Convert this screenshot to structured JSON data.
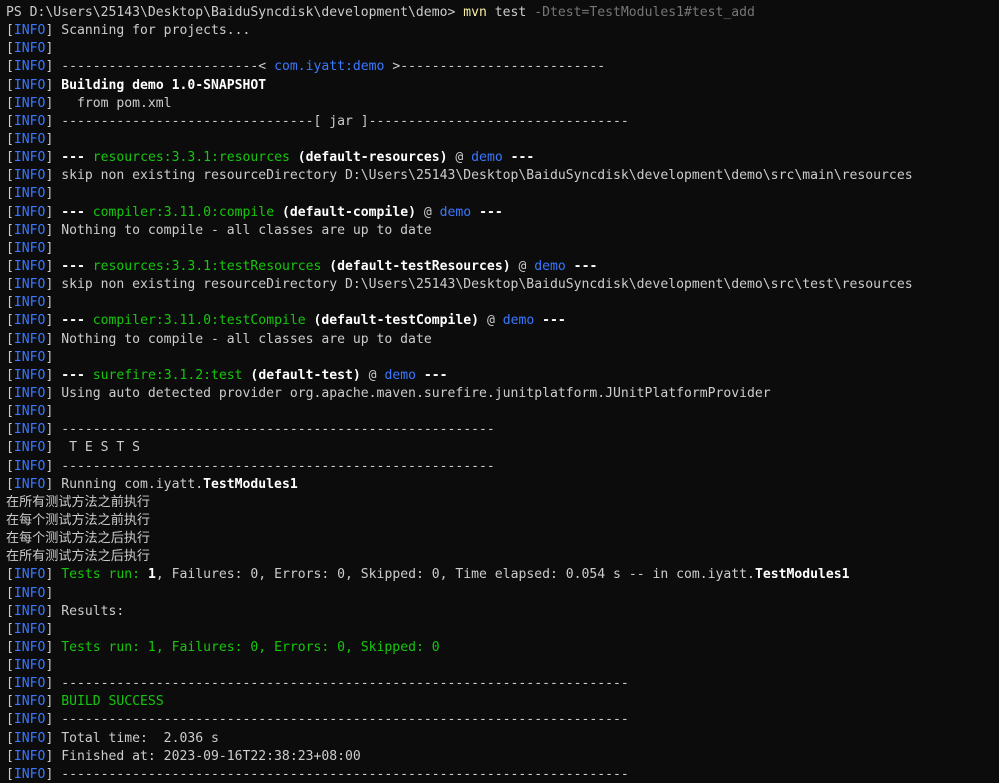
{
  "colors": {
    "background": "#0c0c0c",
    "text": "#cccccc",
    "info": "#3b78ff",
    "plugin": "#16c60c",
    "artifact": "#3b78ff",
    "command": "#f9f1a5",
    "argument": "#767676"
  },
  "prompt": {
    "path": "PS D:\\Users\\25143\\Desktop\\BaiduSyncdisk\\development\\demo> ",
    "command": "mvn",
    "sub": " test ",
    "args": "-Dtest=TestModules1#test_add"
  },
  "lines": [
    [
      {
        "t": "[",
        "c": "gray"
      },
      {
        "t": "INFO",
        "c": "blue"
      },
      {
        "t": "] Scanning for projects...",
        "c": "gray"
      }
    ],
    [
      {
        "t": "[",
        "c": "gray"
      },
      {
        "t": "INFO",
        "c": "blue"
      },
      {
        "t": "]",
        "c": "gray"
      }
    ],
    [
      {
        "t": "[",
        "c": "gray"
      },
      {
        "t": "INFO",
        "c": "blue"
      },
      {
        "t": "] -------------------------< ",
        "c": "gray"
      },
      {
        "t": "com.iyatt:demo",
        "c": "blue"
      },
      {
        "t": " >--------------------------",
        "c": "gray"
      }
    ],
    [
      {
        "t": "[",
        "c": "gray"
      },
      {
        "t": "INFO",
        "c": "blue"
      },
      {
        "t": "] ",
        "c": "gray"
      },
      {
        "t": "Building demo 1.0-SNAPSHOT",
        "c": "bold"
      }
    ],
    [
      {
        "t": "[",
        "c": "gray"
      },
      {
        "t": "INFO",
        "c": "blue"
      },
      {
        "t": "]   from pom.xml",
        "c": "gray"
      }
    ],
    [
      {
        "t": "[",
        "c": "gray"
      },
      {
        "t": "INFO",
        "c": "blue"
      },
      {
        "t": "] --------------------------------[ jar ]---------------------------------",
        "c": "gray"
      }
    ],
    [
      {
        "t": "[",
        "c": "gray"
      },
      {
        "t": "INFO",
        "c": "blue"
      },
      {
        "t": "]",
        "c": "gray"
      }
    ],
    [
      {
        "t": "[",
        "c": "gray"
      },
      {
        "t": "INFO",
        "c": "blue"
      },
      {
        "t": "] ",
        "c": "gray"
      },
      {
        "t": "--- ",
        "c": "bold"
      },
      {
        "t": "resources:3.3.1:resources",
        "c": "green"
      },
      {
        "t": " (default-resources)",
        "c": "bold"
      },
      {
        "t": " @ ",
        "c": "gray"
      },
      {
        "t": "demo",
        "c": "blue"
      },
      {
        "t": " ---",
        "c": "bold"
      }
    ],
    [
      {
        "t": "[",
        "c": "gray"
      },
      {
        "t": "INFO",
        "c": "blue"
      },
      {
        "t": "] skip non existing resourceDirectory D:\\Users\\25143\\Desktop\\BaiduSyncdisk\\development\\demo\\src\\main\\resources",
        "c": "gray"
      }
    ],
    [
      {
        "t": "[",
        "c": "gray"
      },
      {
        "t": "INFO",
        "c": "blue"
      },
      {
        "t": "]",
        "c": "gray"
      }
    ],
    [
      {
        "t": "[",
        "c": "gray"
      },
      {
        "t": "INFO",
        "c": "blue"
      },
      {
        "t": "] ",
        "c": "gray"
      },
      {
        "t": "--- ",
        "c": "bold"
      },
      {
        "t": "compiler:3.11.0:compile",
        "c": "green"
      },
      {
        "t": " (default-compile)",
        "c": "bold"
      },
      {
        "t": " @ ",
        "c": "gray"
      },
      {
        "t": "demo",
        "c": "blue"
      },
      {
        "t": " ---",
        "c": "bold"
      }
    ],
    [
      {
        "t": "[",
        "c": "gray"
      },
      {
        "t": "INFO",
        "c": "blue"
      },
      {
        "t": "] Nothing to compile - all classes are up to date",
        "c": "gray"
      }
    ],
    [
      {
        "t": "[",
        "c": "gray"
      },
      {
        "t": "INFO",
        "c": "blue"
      },
      {
        "t": "]",
        "c": "gray"
      }
    ],
    [
      {
        "t": "[",
        "c": "gray"
      },
      {
        "t": "INFO",
        "c": "blue"
      },
      {
        "t": "] ",
        "c": "gray"
      },
      {
        "t": "--- ",
        "c": "bold"
      },
      {
        "t": "resources:3.3.1:testResources",
        "c": "green"
      },
      {
        "t": " (default-testResources)",
        "c": "bold"
      },
      {
        "t": " @ ",
        "c": "gray"
      },
      {
        "t": "demo",
        "c": "blue"
      },
      {
        "t": " ---",
        "c": "bold"
      }
    ],
    [
      {
        "t": "[",
        "c": "gray"
      },
      {
        "t": "INFO",
        "c": "blue"
      },
      {
        "t": "] skip non existing resourceDirectory D:\\Users\\25143\\Desktop\\BaiduSyncdisk\\development\\demo\\src\\test\\resources",
        "c": "gray"
      }
    ],
    [
      {
        "t": "[",
        "c": "gray"
      },
      {
        "t": "INFO",
        "c": "blue"
      },
      {
        "t": "]",
        "c": "gray"
      }
    ],
    [
      {
        "t": "[",
        "c": "gray"
      },
      {
        "t": "INFO",
        "c": "blue"
      },
      {
        "t": "] ",
        "c": "gray"
      },
      {
        "t": "--- ",
        "c": "bold"
      },
      {
        "t": "compiler:3.11.0:testCompile",
        "c": "green"
      },
      {
        "t": " (default-testCompile)",
        "c": "bold"
      },
      {
        "t": " @ ",
        "c": "gray"
      },
      {
        "t": "demo",
        "c": "blue"
      },
      {
        "t": " ---",
        "c": "bold"
      }
    ],
    [
      {
        "t": "[",
        "c": "gray"
      },
      {
        "t": "INFO",
        "c": "blue"
      },
      {
        "t": "] Nothing to compile - all classes are up to date",
        "c": "gray"
      }
    ],
    [
      {
        "t": "[",
        "c": "gray"
      },
      {
        "t": "INFO",
        "c": "blue"
      },
      {
        "t": "]",
        "c": "gray"
      }
    ],
    [
      {
        "t": "[",
        "c": "gray"
      },
      {
        "t": "INFO",
        "c": "blue"
      },
      {
        "t": "] ",
        "c": "gray"
      },
      {
        "t": "--- ",
        "c": "bold"
      },
      {
        "t": "surefire:3.1.2:test",
        "c": "green"
      },
      {
        "t": " (default-test)",
        "c": "bold"
      },
      {
        "t": " @ ",
        "c": "gray"
      },
      {
        "t": "demo",
        "c": "blue"
      },
      {
        "t": " ---",
        "c": "bold"
      }
    ],
    [
      {
        "t": "[",
        "c": "gray"
      },
      {
        "t": "INFO",
        "c": "blue"
      },
      {
        "t": "] Using auto detected provider org.apache.maven.surefire.junitplatform.JUnitPlatformProvider",
        "c": "gray"
      }
    ],
    [
      {
        "t": "[",
        "c": "gray"
      },
      {
        "t": "INFO",
        "c": "blue"
      },
      {
        "t": "]",
        "c": "gray"
      }
    ],
    [
      {
        "t": "[",
        "c": "gray"
      },
      {
        "t": "INFO",
        "c": "blue"
      },
      {
        "t": "] -------------------------------------------------------",
        "c": "gray"
      }
    ],
    [
      {
        "t": "[",
        "c": "gray"
      },
      {
        "t": "INFO",
        "c": "blue"
      },
      {
        "t": "]  T E S T S",
        "c": "gray"
      }
    ],
    [
      {
        "t": "[",
        "c": "gray"
      },
      {
        "t": "INFO",
        "c": "blue"
      },
      {
        "t": "] -------------------------------------------------------",
        "c": "gray"
      }
    ],
    [
      {
        "t": "[",
        "c": "gray"
      },
      {
        "t": "INFO",
        "c": "blue"
      },
      {
        "t": "] Running com.iyatt.",
        "c": "gray"
      },
      {
        "t": "TestModules1",
        "c": "bold"
      }
    ],
    [
      {
        "t": "在所有测试方法之前执行",
        "c": "gray",
        "cjk": true
      }
    ],
    [
      {
        "t": "在每个测试方法之前执行",
        "c": "gray",
        "cjk": true
      }
    ],
    [
      {
        "t": "在每个测试方法之后执行",
        "c": "gray",
        "cjk": true
      }
    ],
    [
      {
        "t": "在所有测试方法之后执行",
        "c": "gray",
        "cjk": true
      }
    ],
    [
      {
        "t": "[",
        "c": "gray"
      },
      {
        "t": "INFO",
        "c": "blue"
      },
      {
        "t": "] ",
        "c": "gray"
      },
      {
        "t": "Tests run: ",
        "c": "green"
      },
      {
        "t": "1",
        "c": "bold"
      },
      {
        "t": ", Failures: 0, Errors: 0, Skipped: 0, Time elapsed: 0.054 s -- in com.iyatt.",
        "c": "gray"
      },
      {
        "t": "TestModules1",
        "c": "bold"
      }
    ],
    [
      {
        "t": "[",
        "c": "gray"
      },
      {
        "t": "INFO",
        "c": "blue"
      },
      {
        "t": "]",
        "c": "gray"
      }
    ],
    [
      {
        "t": "[",
        "c": "gray"
      },
      {
        "t": "INFO",
        "c": "blue"
      },
      {
        "t": "] Results:",
        "c": "gray"
      }
    ],
    [
      {
        "t": "[",
        "c": "gray"
      },
      {
        "t": "INFO",
        "c": "blue"
      },
      {
        "t": "]",
        "c": "gray"
      }
    ],
    [
      {
        "t": "[",
        "c": "gray"
      },
      {
        "t": "INFO",
        "c": "blue"
      },
      {
        "t": "] ",
        "c": "gray"
      },
      {
        "t": "Tests run: 1, Failures: 0, Errors: 0, Skipped: 0",
        "c": "green"
      }
    ],
    [
      {
        "t": "[",
        "c": "gray"
      },
      {
        "t": "INFO",
        "c": "blue"
      },
      {
        "t": "]",
        "c": "gray"
      }
    ],
    [
      {
        "t": "[",
        "c": "gray"
      },
      {
        "t": "INFO",
        "c": "blue"
      },
      {
        "t": "] ------------------------------------------------------------------------",
        "c": "gray"
      }
    ],
    [
      {
        "t": "[",
        "c": "gray"
      },
      {
        "t": "INFO",
        "c": "blue"
      },
      {
        "t": "] ",
        "c": "gray"
      },
      {
        "t": "BUILD SUCCESS",
        "c": "green"
      }
    ],
    [
      {
        "t": "[",
        "c": "gray"
      },
      {
        "t": "INFO",
        "c": "blue"
      },
      {
        "t": "] ------------------------------------------------------------------------",
        "c": "gray"
      }
    ],
    [
      {
        "t": "[",
        "c": "gray"
      },
      {
        "t": "INFO",
        "c": "blue"
      },
      {
        "t": "] Total time:  2.036 s",
        "c": "gray"
      }
    ],
    [
      {
        "t": "[",
        "c": "gray"
      },
      {
        "t": "INFO",
        "c": "blue"
      },
      {
        "t": "] Finished at: 2023-09-16T22:38:23+08:00",
        "c": "gray"
      }
    ],
    [
      {
        "t": "[",
        "c": "gray"
      },
      {
        "t": "INFO",
        "c": "blue"
      },
      {
        "t": "] ------------------------------------------------------------------------",
        "c": "gray"
      }
    ]
  ]
}
